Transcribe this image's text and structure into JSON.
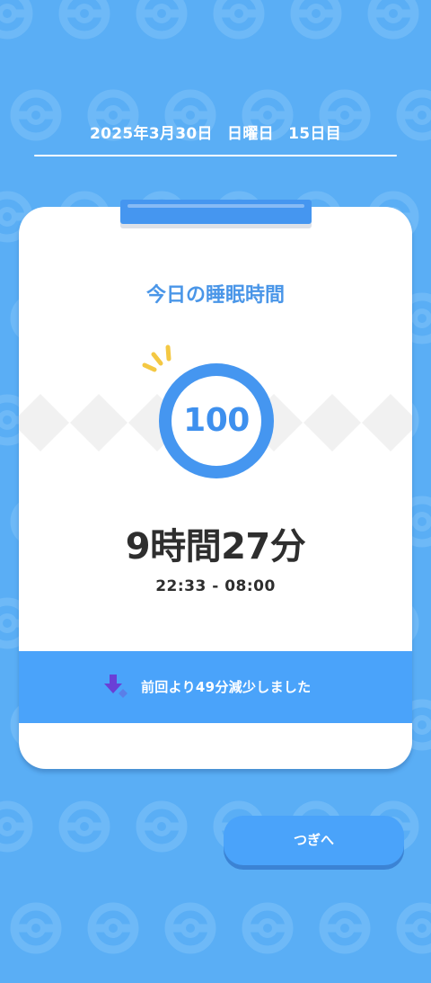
{
  "header": {
    "date": "2025年3月30日",
    "weekday": "日曜日",
    "day_count": "15日目"
  },
  "card": {
    "title": "今日の睡眠時間",
    "score": "100",
    "duration": "9時間27分",
    "time_range": "22:33 - 08:00",
    "comparison": "前回より49分減少しました"
  },
  "actions": {
    "next_label": "つぎへ"
  },
  "icons": {
    "background": "poke-ball-pattern-icon",
    "sparkle": "sparkle-icon",
    "comparison": "arrow-down-icon"
  },
  "colors": {
    "background": "#5aaef5",
    "accent_blue": "#4596f0",
    "bar_blue": "#4aa3fa",
    "sparkle_yellow": "#f4c843",
    "arrow_purple": "#6a3fd6",
    "text_dark": "#2e2e2e"
  }
}
